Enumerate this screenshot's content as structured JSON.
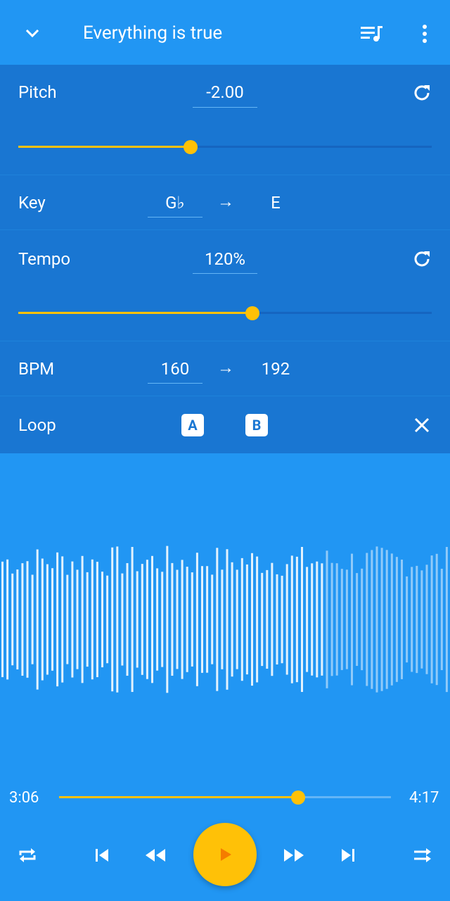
{
  "header": {
    "title": "Everything is true",
    "back_icon": "chevron-down-icon",
    "queue_icon": "queue-music-icon",
    "menu_icon": "more-vert-icon"
  },
  "pitch": {
    "label": "Pitch",
    "value": "-2.00",
    "slider_fraction": 0.417,
    "reset_icon": "refresh-icon"
  },
  "key": {
    "label": "Key",
    "from": "G♭",
    "arrow": "→",
    "to": "E"
  },
  "tempo": {
    "label": "Tempo",
    "value": "120%",
    "slider_fraction": 0.567,
    "reset_icon": "refresh-icon"
  },
  "bpm": {
    "label": "BPM",
    "from": "160",
    "arrow": "→",
    "to": "192"
  },
  "loop": {
    "label": "Loop",
    "a_label": "A",
    "b_label": "B",
    "close_icon": "close-icon"
  },
  "playback": {
    "elapsed": "3:06",
    "total": "4:17",
    "progress_fraction": 0.72
  },
  "controls": {
    "repeat_icon": "repeat-icon",
    "previous_icon": "skip-previous-icon",
    "rewind_icon": "fast-rewind-icon",
    "play_icon": "play-icon",
    "forward_icon": "fast-forward-icon",
    "next_icon": "skip-next-icon",
    "shuffle_icon": "shuffle-icon"
  },
  "colors": {
    "background": "#2196F3",
    "panel": "#1976D2",
    "accent": "#FFC107",
    "play_triangle": "#F57C00"
  }
}
